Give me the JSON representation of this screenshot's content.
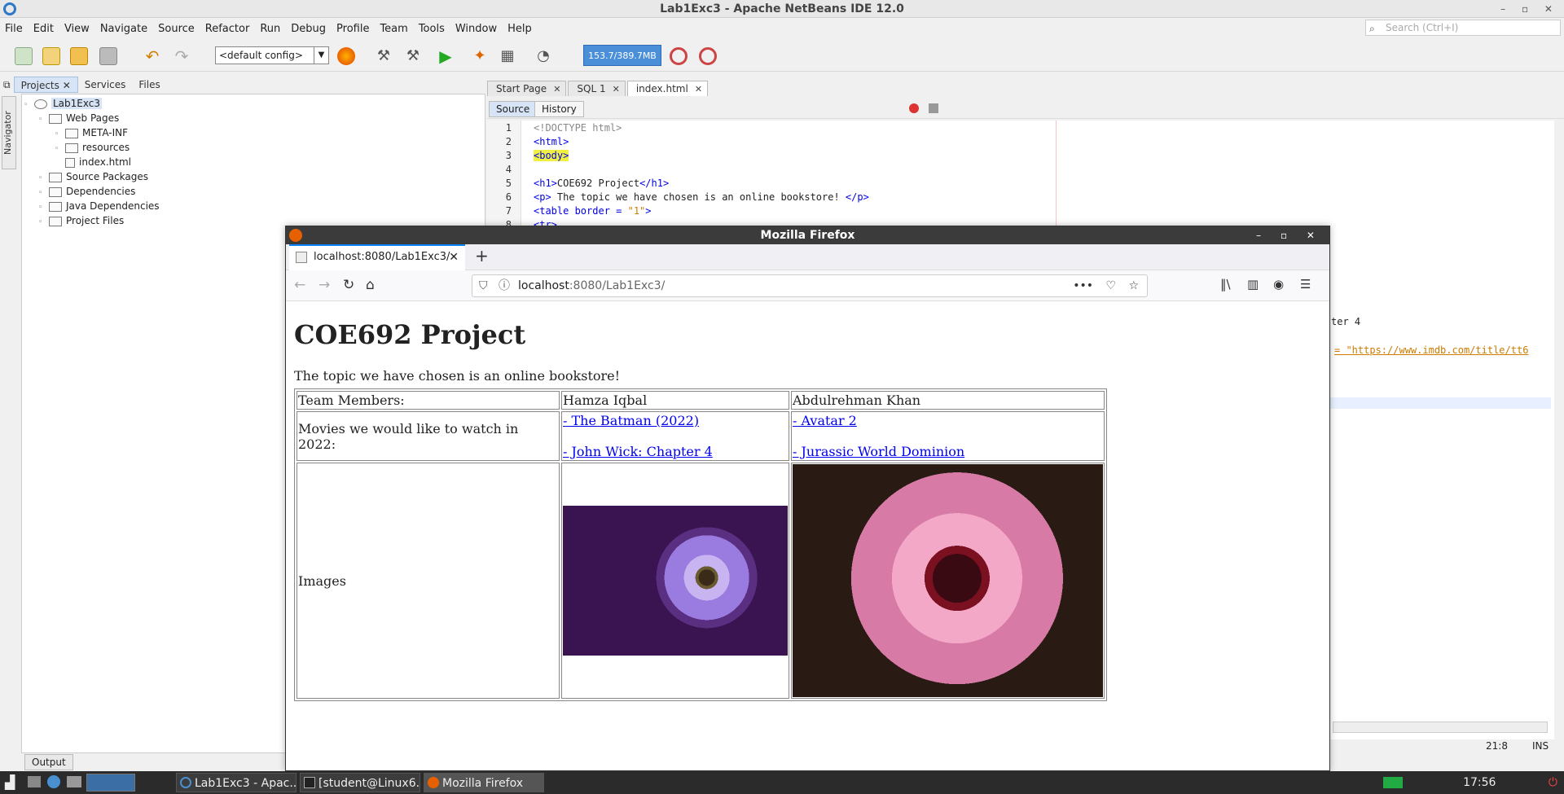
{
  "ide": {
    "title": "Lab1Exc3 - Apache NetBeans IDE 12.0",
    "menus": [
      "File",
      "Edit",
      "View",
      "Navigate",
      "Source",
      "Refactor",
      "Run",
      "Debug",
      "Profile",
      "Team",
      "Tools",
      "Window",
      "Help"
    ],
    "search_placeholder": "Search (Ctrl+I)",
    "config_select": "<default config>",
    "memory": "153.7/389.7MB",
    "panel_tabs": [
      "Projects",
      "Services",
      "Files"
    ],
    "navigator_label": "Navigator",
    "tree": [
      "Lab1Exc3",
      "Web Pages",
      "META-INF",
      "resources",
      "index.html",
      "Source Packages",
      "Dependencies",
      "Java Dependencies",
      "Project Files"
    ],
    "editor_tabs": [
      "Start Page",
      "SQL 1",
      "index.html"
    ],
    "editor_buttons": [
      "Source",
      "History"
    ],
    "line_numbers": [
      "1",
      "2",
      "3",
      "4",
      "5",
      "6",
      "7",
      "8"
    ],
    "code": {
      "l1": "<!DOCTYPE html>",
      "l2": "<html>",
      "l3": "<body>",
      "l5_open": "<h1>",
      "l5_text": "COE692 Project",
      "l5_close": "</h1>",
      "l6_open": "<p>",
      "l6_text": " The topic we have chosen is an online bookstore! ",
      "l6_close": "</p>",
      "l7_tag": "<table border = ",
      "l7_val": "\"1\"",
      "l7_end": ">",
      "l8": "<tr>",
      "behind_fragment_1": "ter 4",
      "behind_fragment_2": "= \"https://www.imdb.com/title/tt6"
    },
    "status": {
      "position": "21:8",
      "mode": "INS"
    },
    "output_tab": "Output"
  },
  "firefox": {
    "title": "Mozilla Firefox",
    "tab_title": "localhost:8080/Lab1Exc3/",
    "url_host": "localhost",
    "url_path": ":8080/Lab1Exc3/",
    "page": {
      "heading": "COE692 Project",
      "intro": "The topic we have chosen is an online bookstore!",
      "table": {
        "row1": [
          "Team Members:",
          "Hamza Iqbal",
          "Abdulrehman Khan"
        ],
        "row2_label": "Movies we would like to watch in 2022:",
        "col1_links": [
          "- The Batman (2022)",
          "- John Wick: Chapter 4"
        ],
        "col2_links": [
          "- Avatar 2",
          "- Jurassic World Dominion"
        ],
        "row3_label": "Images"
      }
    }
  },
  "taskbar": {
    "tasks": [
      "Lab1Exc3 - Apac...",
      "[student@Linux6...",
      "Mozilla Firefox"
    ],
    "clock": "17:56"
  }
}
